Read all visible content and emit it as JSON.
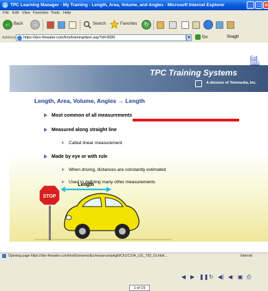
{
  "window": {
    "title": "TPC Learning Manager - My Training - Length, Area, Volume, and Angles - Microsoft Internet Explorer"
  },
  "menu": [
    "File",
    "Edit",
    "View",
    "Favorites",
    "Tools",
    "Help"
  ],
  "toolbar": {
    "back_label": "Back",
    "search_label": "Search",
    "favorites_label": "Favorites"
  },
  "address": {
    "label": "Address",
    "url": "https://dev-fmwater.com/lms/training/item.asp?id=3099",
    "go_label": "Go",
    "snagit_label": "SnagIt"
  },
  "content": {
    "exit_topic": "Exit topic",
    "brand": "TPC Training Systems",
    "brand_sub": "A division of Telemedia, Inc.",
    "slide_title": "Length, Area, Volume, Angles → Length",
    "bullets": [
      "Most common of all measurements",
      "Measured along straight line",
      "Called linear measurement",
      "Made by eye or with rule",
      "When driving, distances are constantly estimated",
      "Used in defining many other measurements"
    ],
    "stop_sign": "STOP",
    "length_label": "Length",
    "page_counter": "1 of 15"
  },
  "status": {
    "text": "Opening page https://dev-fmwater.com/lms/licensees/tpc/resources/pkgN/Ch1/C104_L01_T02_01.html...",
    "zone": "Internet"
  },
  "colors": {
    "titlebar": "#0a5ee0",
    "slide_title": "#1d3e8a",
    "redline": "#e31818",
    "car": "#f3e400"
  }
}
